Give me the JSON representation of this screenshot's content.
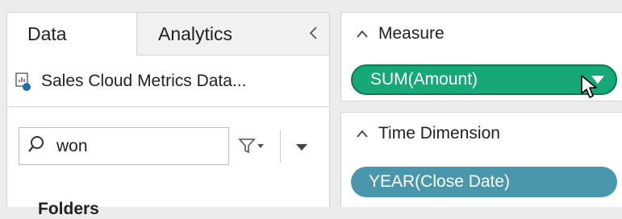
{
  "tabs": [
    {
      "label": "Data"
    },
    {
      "label": "Analytics"
    }
  ],
  "data_source": {
    "name": "Sales Cloud Metrics Data..."
  },
  "search": {
    "value": "won"
  },
  "folders_label": "Folders",
  "measure": {
    "title": "Measure",
    "pill": "SUM(Amount)",
    "color": "#16a876"
  },
  "time_dimension": {
    "title": "Time Dimension",
    "pill": "YEAR(Close Date)",
    "color": "#4a96ad"
  },
  "icons": {
    "collapse": "chevron-left-icon",
    "data_source": "data-source-icon",
    "search": "search-icon",
    "filter": "filter-icon",
    "more": "caret-down-icon",
    "card_collapse": "chevron-up-icon",
    "cursor": "mouse-pointer-icon"
  }
}
